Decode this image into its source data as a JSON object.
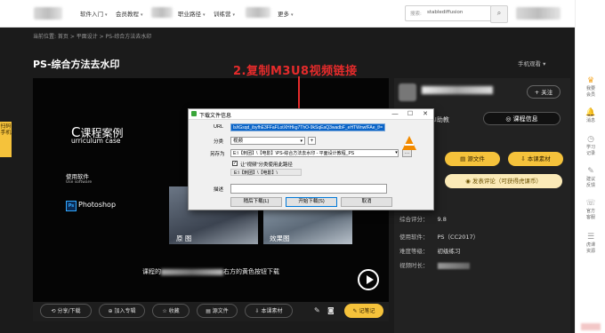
{
  "nav": {
    "items": [
      {
        "label": "软件入门",
        "caret": "▾"
      },
      {
        "label": "会员教程",
        "caret": "▾"
      },
      {
        "label": "职业路径",
        "caret": "▾"
      },
      {
        "label": "训练营",
        "caret": "▾"
      },
      {
        "label": "更多",
        "caret": "▾"
      }
    ],
    "search_label": "搜索:",
    "search_value": "stablediffusion",
    "search_icon": "magnifier-icon"
  },
  "breadcrumb": "当前位置: 首页 > 平面设计 > PS-综合方法去水印",
  "page_title": "PS-综合方法去水印",
  "mobile_view": "手机观看 ▾",
  "side_tab": "扫码手机",
  "annotation": "2.复制M3U8视频链接",
  "video": {
    "course_title": "课程案例",
    "course_sub": "urriculum case",
    "use_soft": "使用软件",
    "use_soft_en": "Use software",
    "ps_badge": "Ps",
    "ps_name": "Photoshop",
    "label_before": "原  图",
    "label_after": "效果图",
    "caption_pre": "课程的",
    "caption_post": "右方的黄色按钮下载"
  },
  "toolbar": {
    "share": "分享/下载",
    "add_album": "加入专辑",
    "favorite": "收藏",
    "source": "源文件",
    "material": "本课素材",
    "notes": "记笔记"
  },
  "panel": {
    "follow": "+ 关注",
    "tab_ai": "AI助教",
    "tab_info": "课程信息",
    "btn_source": "源文件",
    "btn_material": "本课素材",
    "comment": "发表评论（可获得虎课币）",
    "rating_label": "综合评分：",
    "rating": "9.8",
    "software_label": "使用软件：",
    "software": "PS（CC2017）",
    "level_label": "难度等级：",
    "level": "初级练习",
    "duration_label": "视频时长："
  },
  "rightbar": [
    {
      "icon": "crown-icon",
      "label": "我要\n会员"
    },
    {
      "icon": "bell-icon",
      "label": "消息"
    },
    {
      "icon": "clock-icon",
      "label": "学习\n记录"
    },
    {
      "icon": "edit-icon",
      "label": "建议\n反馈"
    },
    {
      "icon": "service-icon",
      "label": "官方\n客服"
    },
    {
      "icon": "database-icon",
      "label": "虎课\n资源"
    }
  ],
  "dialog": {
    "title": "下载文件信息",
    "url_label": "URL",
    "url_value": "ls/tGsqd_ibyfhE3FFaFLotXHHkg7ThO-9kSqEaQ3wadbF_eHTWnwfFAe_f/=",
    "category_label": "分类",
    "category_value": "视频",
    "save_label": "另存为",
    "save_value": "E:\\【刺团】\\【电影】\\PS-综合方法去水印 - 平面设计教程_PS",
    "remember_label": "让\"视频\"分类使用此路径",
    "path_value": "E:\\【刺团】\\【电影】\\",
    "desc_label": "描述",
    "btn_later": "稍后下载(L)",
    "btn_start": "开始下载(S)",
    "btn_cancel": "取消",
    "close_glyph": "✕",
    "min_glyph": "—",
    "max_glyph": "☐"
  }
}
